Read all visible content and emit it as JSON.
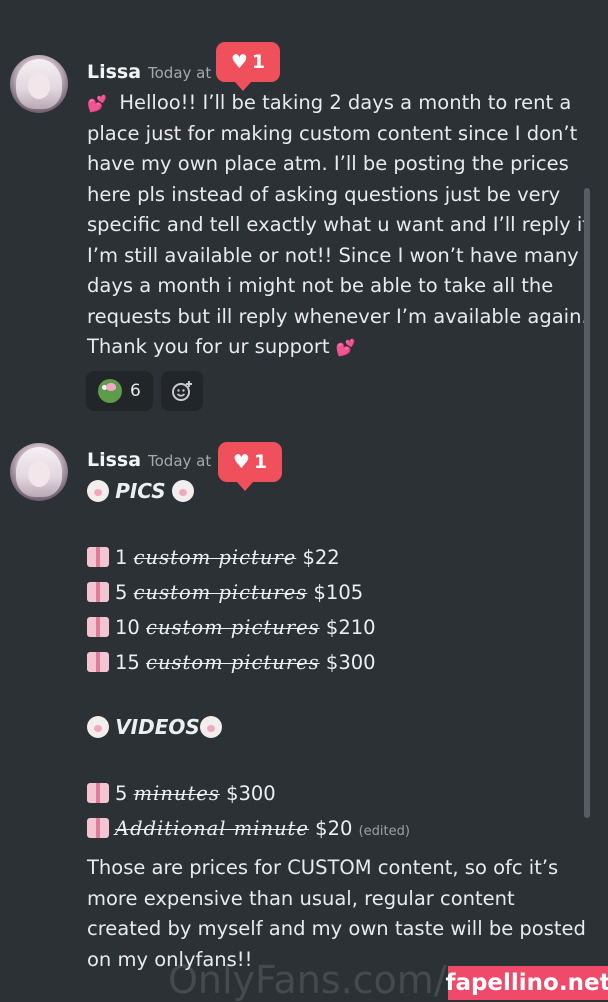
{
  "messages": [
    {
      "author": "Lissa",
      "timestamp": "Today at",
      "likes": "1",
      "lines": [
        "Helloo!! I’ll be taking 2 days a month to rent a",
        "place just for making custom content since I don’t",
        "have my own place atm. I’ll be posting the prices",
        "here pls instead of asking questions just be very",
        "specific and tell exactly what u want and I’ll reply if",
        "I’m still available or not!! Since I won’t have many",
        "days a month i might not be able to take all the",
        "requests but ill reply whenever I’m available again.",
        "Thank you for ur support"
      ],
      "reactions": [
        {
          "icon": "pepe-emoji-icon",
          "count": "6"
        },
        {
          "icon": "add-reaction-icon"
        }
      ]
    },
    {
      "author": "Lissa",
      "timestamp": "Today at",
      "likes": "1",
      "pics_heading": "PICS",
      "pics": [
        {
          "qty": "1",
          "item": "custom picture",
          "price": "$22"
        },
        {
          "qty": "5",
          "item": "custom pictures",
          "price": "$105"
        },
        {
          "qty": "10",
          "item": "custom pictures",
          "price": "$210"
        },
        {
          "qty": "15",
          "item": "custom pictures",
          "price": "$300"
        }
      ],
      "videos_heading": "VIDEOS",
      "videos": [
        {
          "qty": "5",
          "item": "minutes",
          "price": "$300"
        },
        {
          "qty": "",
          "item": "Additional minute",
          "price": "$20"
        }
      ],
      "edited_label": "(edited)",
      "footer_lines": [
        "Those are prices for CUSTOM content, so ofc it’s",
        "more expensive than usual, regular content",
        "created by myself and my own taste will be posted",
        "on my onlyfans!!"
      ]
    }
  ],
  "watermark": "OnlyFans.com/",
  "site_tag": "fapellino.net"
}
